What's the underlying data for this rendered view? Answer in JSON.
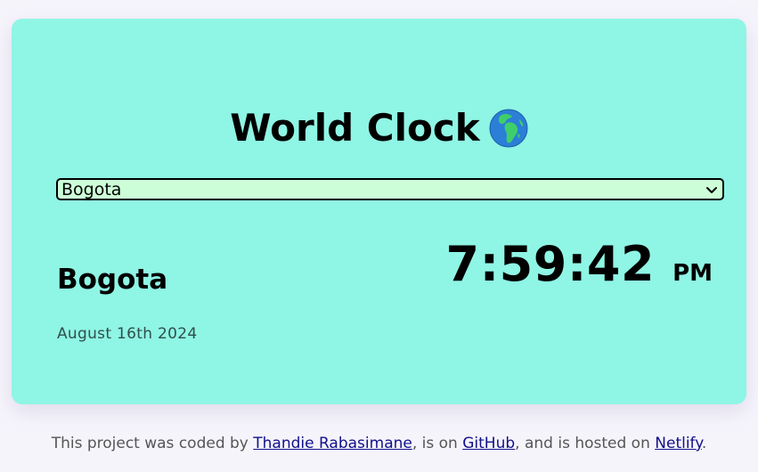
{
  "header": {
    "title": "World Clock",
    "title_icon": "globe-earth-africa-icon"
  },
  "city_select": {
    "value": "Bogota",
    "icon": "chevron-down-icon"
  },
  "city": {
    "name": "Bogota",
    "date": "August 16th 2024",
    "time": "7:59:42",
    "ampm": "PM"
  },
  "footer": {
    "text_1": "This project was coded by ",
    "author_link": "Thandie Rabasimane",
    "text_2": ", is on ",
    "github_link": "GitHub",
    "text_3": ", and is hosted on ",
    "netlify_link": "Netlify",
    "text_4": "."
  },
  "colors": {
    "page_background": "#f6f4fb",
    "card_background": "#8ff5e4",
    "select_background": "#ccffd8",
    "link": "#10108a"
  }
}
